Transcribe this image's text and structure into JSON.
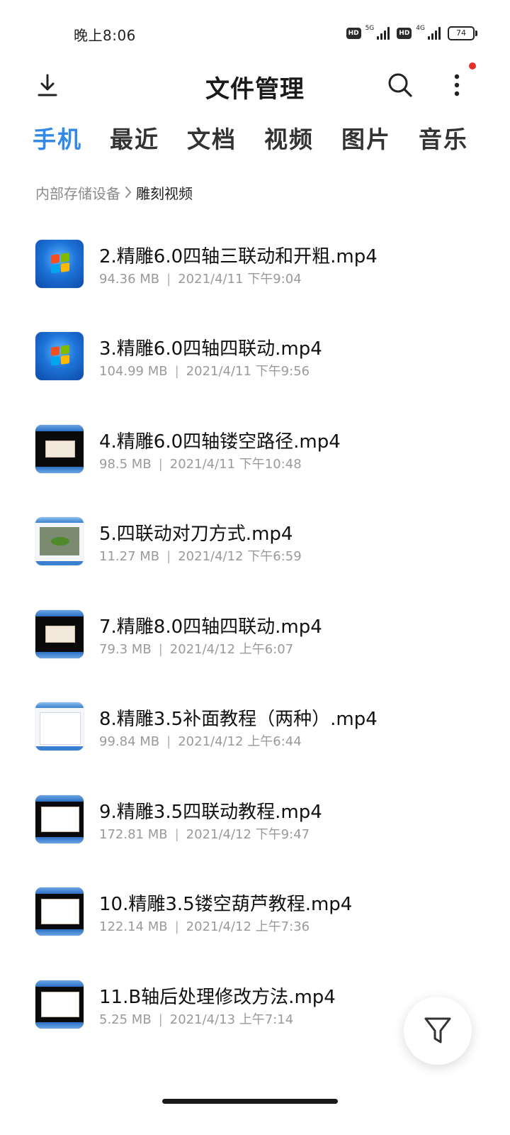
{
  "status_bar": {
    "time": "晚上8:06",
    "net1": "5G",
    "net2": "4G",
    "hd": "HD",
    "battery": "74"
  },
  "header": {
    "title": "文件管理",
    "download_icon": "download-icon",
    "search_icon": "search-icon",
    "more_icon": "more-vertical-icon",
    "notify_color": "#e8302b"
  },
  "tabs": [
    {
      "label": "手机",
      "active": true
    },
    {
      "label": "最近",
      "active": false
    },
    {
      "label": "文档",
      "active": false
    },
    {
      "label": "视频",
      "active": false
    },
    {
      "label": "图片",
      "active": false
    },
    {
      "label": "音乐",
      "active": false
    }
  ],
  "breadcrumb": {
    "root": "内部存储设备",
    "current": "雕刻视频"
  },
  "files": [
    {
      "name": "2.精雕6.0四轴三联动和开粗.mp4",
      "size": "94.36 MB",
      "date": "2021/4/11 下午9:04",
      "thumb": "windows-logo"
    },
    {
      "name": "3.精雕6.0四轴四联动.mp4",
      "size": "104.99 MB",
      "date": "2021/4/11 下午9:56",
      "thumb": "windows-logo"
    },
    {
      "name": "4.精雕6.0四轴镂空路径.mp4",
      "size": "98.5 MB",
      "date": "2021/4/11 下午10:48",
      "thumb": "dark-dialog"
    },
    {
      "name": "5.四联动对刀方式.mp4",
      "size": "11.27 MB",
      "date": "2021/4/12 下午6:59",
      "thumb": "green-model"
    },
    {
      "name": "7.精雕8.0四轴四联动.mp4",
      "size": "79.3 MB",
      "date": "2021/4/12 上午6:07",
      "thumb": "dark-dialog"
    },
    {
      "name": "8.精雕3.5补面教程（两种）.mp4",
      "size": "99.84 MB",
      "date": "2021/4/12 上午6:44",
      "thumb": "light-doc"
    },
    {
      "name": "9.精雕3.5四联动教程.mp4",
      "size": "172.81 MB",
      "date": "2021/4/12 下午9:47",
      "thumb": "dark-window"
    },
    {
      "name": "10.精雕3.5镂空葫芦教程.mp4",
      "size": "122.14 MB",
      "date": "2021/4/12 上午7:36",
      "thumb": "dark-window"
    },
    {
      "name": "11.B轴后处理修改方法.mp4",
      "size": "5.25 MB",
      "date": "2021/4/13 上午7:14",
      "thumb": "dark-window"
    }
  ],
  "fab": {
    "icon": "filter-icon"
  },
  "colors": {
    "accent": "#3389e8",
    "meta": "#9a9a9a"
  }
}
